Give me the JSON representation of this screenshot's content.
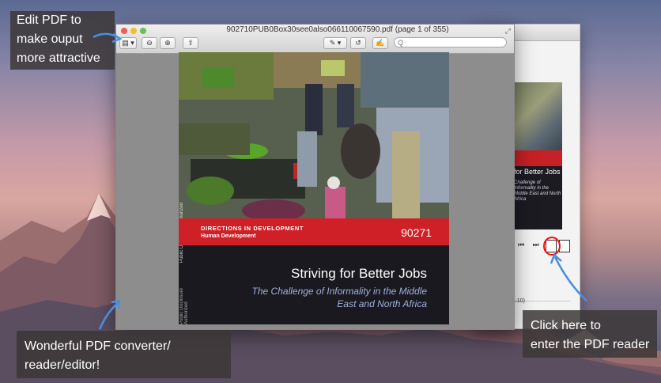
{
  "window": {
    "title": "902710PUB0Box30see0also066110067590.pdf (page 1 of 355)",
    "search_placeholder": "Q"
  },
  "toolbar": {
    "sidebar_label": "▤ ▾",
    "zoom_out_label": "⊖",
    "zoom_in_label": "⊕",
    "share_label": "⇪",
    "annotate_label": "✎ ▾",
    "rotate_label": "↺",
    "edit_label": "✍"
  },
  "cover": {
    "vertical_text_1": "Public Disclosure Authorized",
    "vertical_text_2": "Public Disclosure Authorized",
    "series": "DIRECTIONS IN DEVELOPMENT",
    "subseries": "Human Development",
    "report_number": "90271",
    "title": "Striving for Better Jobs",
    "subtitle": "The Challenge of Informality in the Middle East and North Africa"
  },
  "back_window": {
    "title": "for Better Jobs",
    "subtitle": "Challenge of Informality in the Middle East and North Africa",
    "small_text": "3–10)"
  },
  "callouts": {
    "edit_pdf": [
      "Edit PDF to",
      "make ouput",
      "more attractive"
    ],
    "converter": [
      "Wonderful PDF converter/",
      "reader/editor!"
    ],
    "reader": [
      "Click here to",
      "enter the PDF reader"
    ]
  },
  "colors": {
    "red_band": "#cf2027",
    "cover_dark": "#1a191f",
    "callout_bg": "#3c3737",
    "arrow": "#4a8ee0",
    "highlight": "#e11111"
  },
  "icons": [
    "reader-icon",
    "export-icon",
    "skip-back-icon",
    "skip-forward-icon",
    "search-icon",
    "zoom-in-icon",
    "zoom-out-icon",
    "share-icon",
    "rotate-icon",
    "edit-icon",
    "sidebar-icon",
    "expand-icon"
  ]
}
